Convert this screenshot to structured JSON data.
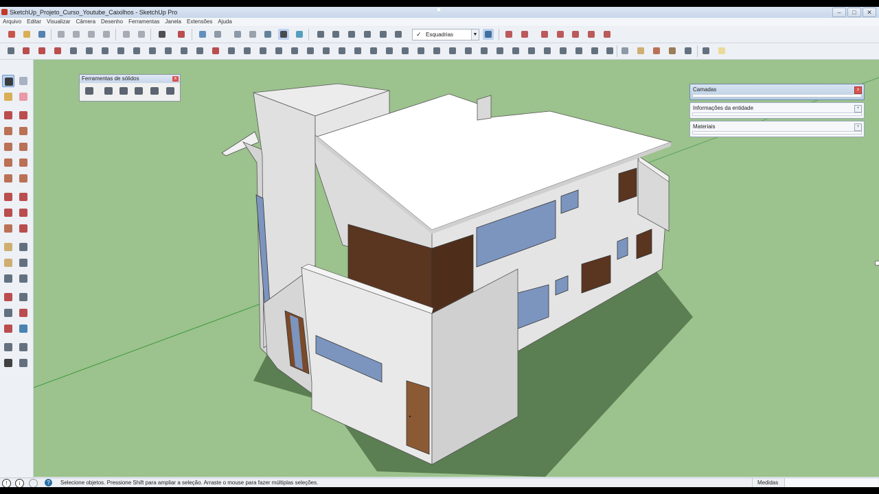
{
  "window": {
    "title": "SketchUp_Projeto_Curso_Youtube_Caixilhos - SketchUp Pro",
    "controls": [
      "–",
      "□",
      "✕"
    ]
  },
  "menubar": {
    "items": [
      "Arquivo",
      "Editar",
      "Visualizar",
      "Câmera",
      "Desenho",
      "Ferramentas",
      "Janela",
      "Extensões",
      "Ajuda"
    ]
  },
  "toolbar": {
    "style_dropdown": {
      "checked": "✓",
      "label": "Esquadrias"
    }
  },
  "solid_tools": {
    "title": "Ferramentas de sólidos",
    "close": "x"
  },
  "trays": [
    {
      "label": "Camadas",
      "button": "x",
      "state": "active"
    },
    {
      "label": "Informações da entidade",
      "button": "+"
    },
    {
      "label": "Materiais",
      "button": "+"
    }
  ],
  "statusbar": {
    "icons": [
      "!",
      "i",
      "?"
    ],
    "message": "Selecione objetos. Pressione Shift para ampliar a seleção. Arraste o mouse para fazer múltiplas seleções.",
    "measure_label": "Medidas",
    "measure_value": ""
  },
  "colors": {
    "ground": "#9cc28d",
    "wall": "#e2e2e2",
    "wall_shade": "#bdbdbd",
    "roof": "#ffffff",
    "shutter": "#5a3520",
    "glass": "#7c95bf",
    "shadow": "#5b7e52"
  }
}
